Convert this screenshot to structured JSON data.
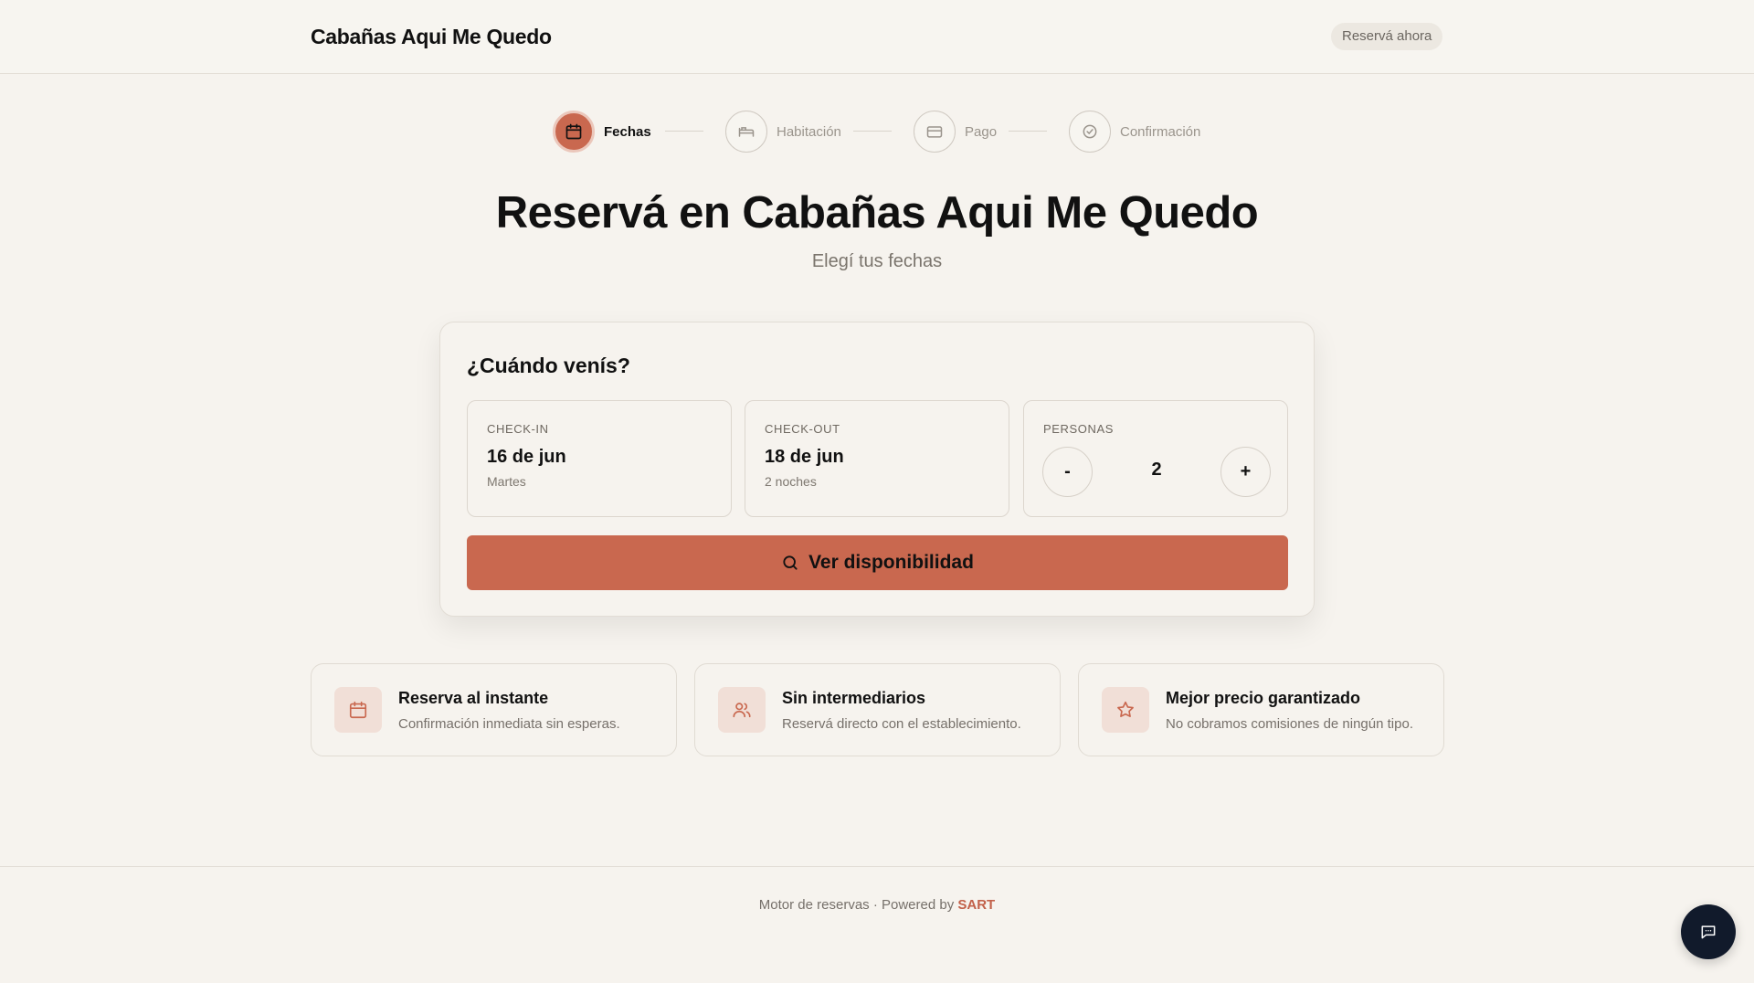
{
  "header": {
    "brand": "Cabañas Aqui Me Quedo",
    "reserve_button": "Reservá ahora"
  },
  "stepper": {
    "steps": [
      {
        "label": "Fechas",
        "icon": "calendar-icon",
        "active": true
      },
      {
        "label": "Habitación",
        "icon": "bed-icon",
        "active": false
      },
      {
        "label": "Pago",
        "icon": "credit-card-icon",
        "active": false
      },
      {
        "label": "Confirmación",
        "icon": "check-circle-icon",
        "active": false
      }
    ]
  },
  "hero": {
    "title": "Reservá en Cabañas Aqui Me Quedo",
    "subtitle": "Elegí tus fechas"
  },
  "booking_card": {
    "title": "¿Cuándo venís?",
    "checkin": {
      "label": "CHECK-IN",
      "value": "16 de jun",
      "sub": "Martes"
    },
    "checkout": {
      "label": "CHECK-OUT",
      "value": "18 de jun",
      "sub": "2 noches"
    },
    "guests": {
      "label": "PERSONAS",
      "value": "2",
      "minus": "-",
      "plus": "+"
    },
    "cta": "Ver disponibilidad"
  },
  "features": [
    {
      "title": "Reserva al instante",
      "desc": "Confirmación inmediata sin esperas.",
      "icon": "calendar-icon"
    },
    {
      "title": "Sin intermediarios",
      "desc": "Reservá directo con el establecimiento.",
      "icon": "users-icon"
    },
    {
      "title": "Mejor precio garantizado",
      "desc": "No cobramos comisiones de ningún tipo.",
      "icon": "star-icon"
    }
  ],
  "footer": {
    "text": "Motor de reservas · Powered by ",
    "brand": "SART"
  },
  "colors": {
    "accent": "#c9684f",
    "background": "#f6f3ee",
    "fab": "#111a2b"
  }
}
